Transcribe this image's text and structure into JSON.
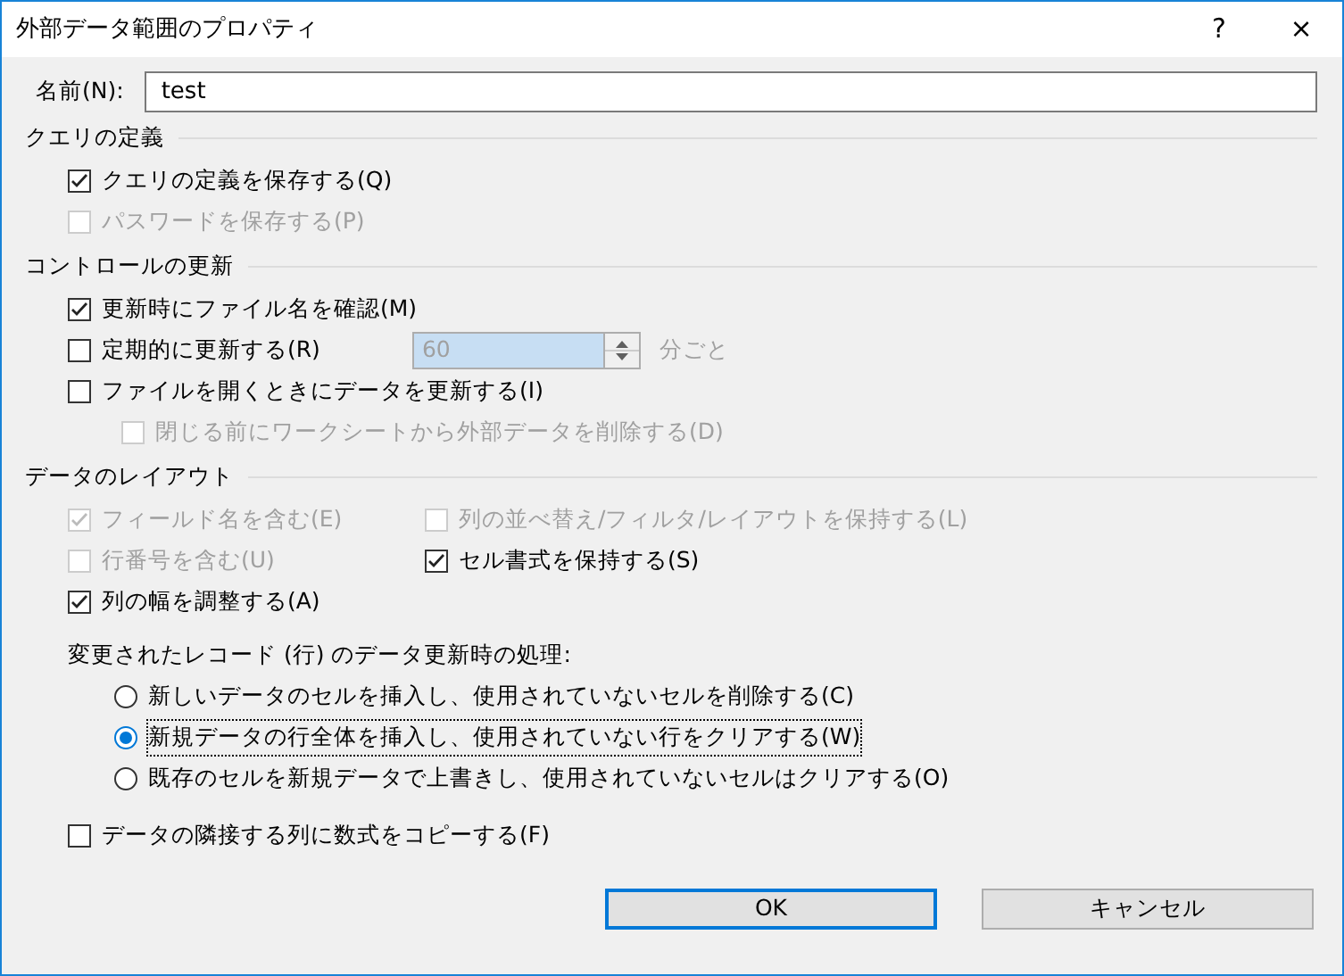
{
  "window": {
    "title": "外部データ範囲のプロパティ",
    "help": "?",
    "close": "×"
  },
  "name_field": {
    "label": "名前(N):",
    "value": "test"
  },
  "query_section": {
    "title": "クエリの定義",
    "items": [
      {
        "label": "クエリの定義を保存する(Q)",
        "checked": true,
        "disabled": false
      },
      {
        "label": "パスワードを保存する(P)",
        "checked": false,
        "disabled": true
      }
    ]
  },
  "refresh_section": {
    "title": "コントロールの更新",
    "items": [
      {
        "kind": "checkbox",
        "label": "更新時にファイル名を確認(M)",
        "checked": true,
        "disabled": false
      },
      {
        "kind": "interval",
        "label": "定期的に更新する(R)",
        "checked": false,
        "disabled": false,
        "value": "60",
        "value_disabled": true,
        "unit": "分ごと"
      },
      {
        "kind": "checkbox",
        "label": "ファイルを開くときにデータを更新する(I)",
        "checked": false,
        "disabled": false,
        "children": [
          {
            "label": "閉じる前にワークシートから外部データを削除する(D)",
            "checked": false,
            "disabled": true
          }
        ]
      }
    ]
  },
  "layout_section": {
    "title": "データのレイアウト",
    "rows": [
      [
        {
          "label": "フィールド名を含む(E)",
          "checked": true,
          "disabled": true
        },
        {
          "label": "列の並べ替え/フィルタ/レイアウトを保持する(L)",
          "checked": false,
          "disabled": true
        }
      ],
      [
        {
          "label": "行番号を含む(U)",
          "checked": false,
          "disabled": true
        },
        {
          "label": "セル書式を保持する(S)",
          "checked": true,
          "disabled": false
        }
      ],
      [
        {
          "label": "列の幅を調整する(A)",
          "checked": true,
          "disabled": false
        }
      ]
    ],
    "update_group": {
      "label": "変更されたレコード (行) のデータ更新時の処理:",
      "options": [
        {
          "label": "新しいデータのセルを挿入し、使用されていないセルを削除する(C)",
          "selected": false,
          "focused": false
        },
        {
          "label": "新規データの行全体を挿入し、使用されていない行をクリアする(W)",
          "selected": true,
          "focused": true
        },
        {
          "label": "既存のセルを新規データで上書きし、使用されていないセルはクリアする(O)",
          "selected": false,
          "focused": false
        }
      ]
    },
    "copy_formulas": {
      "label": "データの隣接する列に数式をコピーする(F)",
      "checked": false,
      "disabled": false
    }
  },
  "buttons": [
    {
      "label": "OK",
      "default": true
    },
    {
      "label": "キャンセル",
      "default": false
    }
  ]
}
